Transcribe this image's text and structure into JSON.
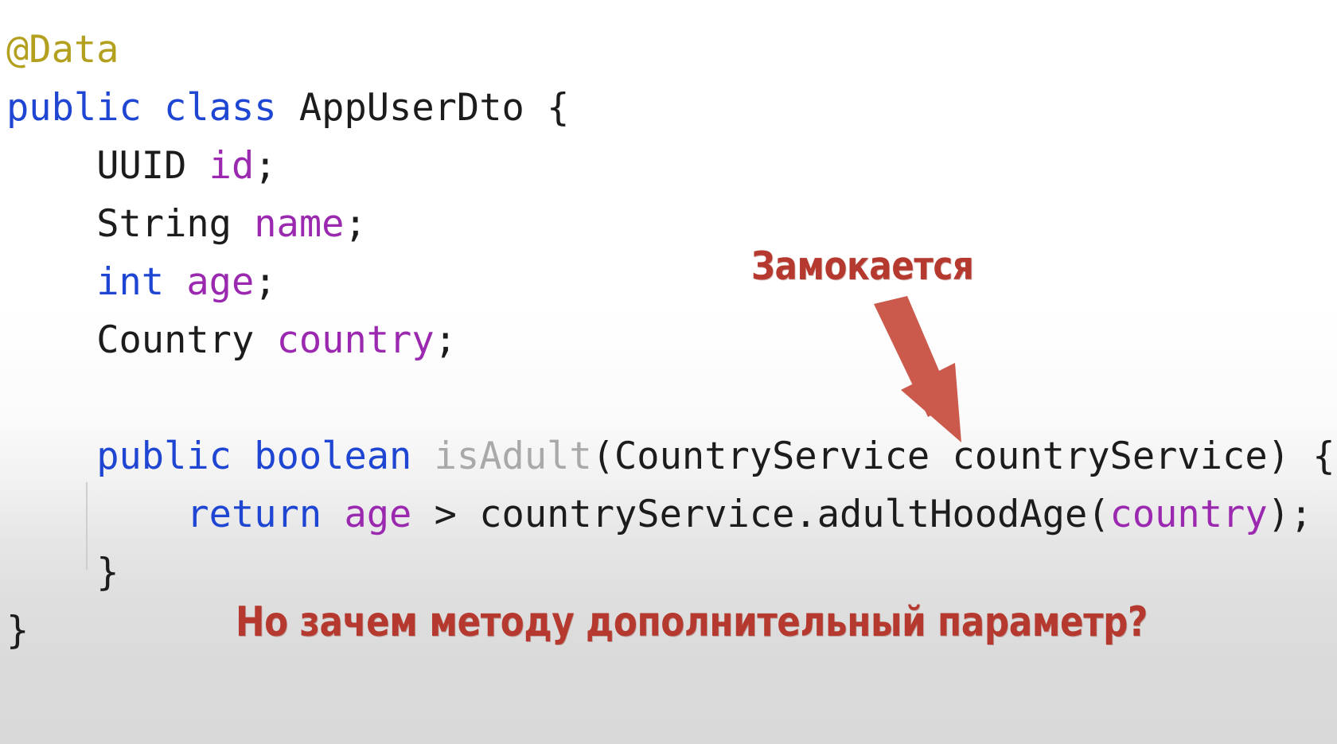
{
  "slide": {
    "language": "java",
    "theme": "light",
    "background_top_color": "#ffffff",
    "background_bottom_color": "#d9d9d9"
  },
  "code": {
    "lines": [
      {
        "id": "line-annotation",
        "indent": 0,
        "tokens": [
          {
            "text": "@Data",
            "kind": "anno"
          }
        ]
      },
      {
        "id": "line-class-decl",
        "indent": 0,
        "tokens": [
          {
            "text": "public",
            "kind": "kw"
          },
          {
            "text": " ",
            "kind": "plain"
          },
          {
            "text": "class",
            "kind": "kw"
          },
          {
            "text": " ",
            "kind": "plain"
          },
          {
            "text": "AppUserDto",
            "kind": "type"
          },
          {
            "text": " {",
            "kind": "punct"
          }
        ]
      },
      {
        "id": "line-field-id",
        "indent": 1,
        "tokens": [
          {
            "text": "UUID",
            "kind": "type"
          },
          {
            "text": " ",
            "kind": "plain"
          },
          {
            "text": "id",
            "kind": "field"
          },
          {
            "text": ";",
            "kind": "punct"
          }
        ]
      },
      {
        "id": "line-field-name",
        "indent": 1,
        "tokens": [
          {
            "text": "String",
            "kind": "type"
          },
          {
            "text": " ",
            "kind": "plain"
          },
          {
            "text": "name",
            "kind": "field"
          },
          {
            "text": ";",
            "kind": "punct"
          }
        ]
      },
      {
        "id": "line-field-age",
        "indent": 1,
        "tokens": [
          {
            "text": "int",
            "kind": "kw"
          },
          {
            "text": " ",
            "kind": "plain"
          },
          {
            "text": "age",
            "kind": "field"
          },
          {
            "text": ";",
            "kind": "punct"
          }
        ]
      },
      {
        "id": "line-field-country",
        "indent": 1,
        "tokens": [
          {
            "text": "Country",
            "kind": "type"
          },
          {
            "text": " ",
            "kind": "plain"
          },
          {
            "text": "country",
            "kind": "field"
          },
          {
            "text": ";",
            "kind": "punct"
          }
        ]
      },
      {
        "id": "line-blank",
        "indent": 0,
        "tokens": []
      },
      {
        "id": "line-method-signature",
        "indent": 1,
        "tokens": [
          {
            "text": "public",
            "kind": "kw"
          },
          {
            "text": " ",
            "kind": "plain"
          },
          {
            "text": "boolean",
            "kind": "kw"
          },
          {
            "text": " ",
            "kind": "plain"
          },
          {
            "text": "isAdult",
            "kind": "mname"
          },
          {
            "text": "(",
            "kind": "punct"
          },
          {
            "text": "CountryService",
            "kind": "type"
          },
          {
            "text": " ",
            "kind": "plain"
          },
          {
            "text": "countryService",
            "kind": "type"
          },
          {
            "text": ") {",
            "kind": "punct"
          }
        ]
      },
      {
        "id": "line-return",
        "indent": 2,
        "tokens": [
          {
            "text": "return",
            "kind": "kw"
          },
          {
            "text": " ",
            "kind": "plain"
          },
          {
            "text": "age",
            "kind": "field"
          },
          {
            "text": " > ",
            "kind": "punct"
          },
          {
            "text": "countryService",
            "kind": "plain"
          },
          {
            "text": ".",
            "kind": "punct"
          },
          {
            "text": "adultHoodAge",
            "kind": "plain"
          },
          {
            "text": "(",
            "kind": "punct"
          },
          {
            "text": "country",
            "kind": "field"
          },
          {
            "text": ");",
            "kind": "punct"
          }
        ]
      },
      {
        "id": "line-close-method",
        "indent": 1,
        "tokens": [
          {
            "text": "}",
            "kind": "punct"
          }
        ]
      },
      {
        "id": "line-close-class",
        "indent": 0,
        "tokens": [
          {
            "text": "}",
            "kind": "punct"
          }
        ]
      }
    ],
    "plain_text": "@Data\npublic class AppUserDto {\n    UUID id;\n    String name;\n    int age;\n    Country country;\n\n    public boolean isAdult(CountryService countryService) {\n        return age > countryService.adultHoodAge(country);\n    }\n}"
  },
  "annotations": {
    "color": "#b5392e",
    "arrow_color": "#cb5a4c",
    "top_note": "Замокается",
    "bottom_note": "Но зачем методу дополнительный параметр?",
    "arrow_target": "countryService"
  },
  "syntax_colors": {
    "keyword": "#1e46d2",
    "annotation": "#b3a01f",
    "type": "#1c1c1c",
    "field": "#9b29b0",
    "method_name": "#a9a9a9",
    "punctuation": "#1c1c1c"
  }
}
